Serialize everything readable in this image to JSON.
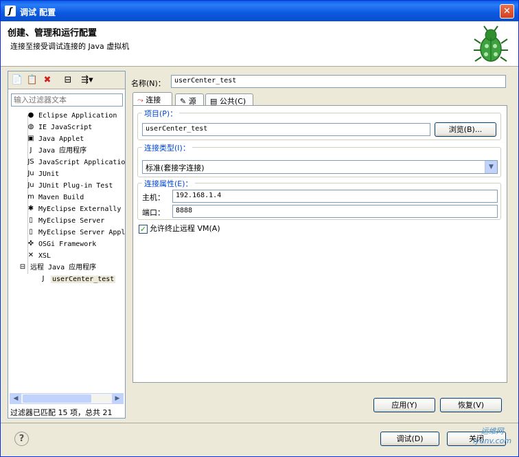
{
  "window": {
    "title": "调试 配置"
  },
  "header": {
    "title": "创建、管理和运行配置",
    "subtitle": "连接至接受调试连接的 Java 虚拟机"
  },
  "left": {
    "filter_placeholder": "输入过滤器文本",
    "tree": [
      {
        "label": "Eclipse Application",
        "icon": "eclipse-icon"
      },
      {
        "label": "IE JavaScript",
        "icon": "globe-icon"
      },
      {
        "label": "Java Applet",
        "icon": "applet-icon"
      },
      {
        "label": "Java 应用程序",
        "icon": "java-app-icon"
      },
      {
        "label": "JavaScript Applicatio",
        "icon": "js-icon"
      },
      {
        "label": "JUnit",
        "icon": "junit-icon"
      },
      {
        "label": "JUnit Plug-in Test",
        "icon": "junit-plugin-icon"
      },
      {
        "label": "Maven Build",
        "icon": "maven-icon"
      },
      {
        "label": "MyEclipse Externally",
        "icon": "external-icon"
      },
      {
        "label": "MyEclipse Server",
        "icon": "server-icon"
      },
      {
        "label": "MyEclipse Server Appl",
        "icon": "server-app-icon"
      },
      {
        "label": "OSGi Framework",
        "icon": "osgi-icon"
      },
      {
        "label": "XSL",
        "icon": "xsl-icon"
      },
      {
        "label": "远程 Java 应用程序",
        "icon": "remote-java-icon"
      },
      {
        "label": "userCenter_test",
        "icon": "config-icon"
      }
    ],
    "status": "过滤器已匹配 15 项，总共 21"
  },
  "right": {
    "name_label": "名称(N)：",
    "name_value": "userCenter_test",
    "tabs": [
      {
        "label": "连接",
        "icon": "connect-icon"
      },
      {
        "label": "源",
        "icon": "source-icon"
      },
      {
        "label": "公共(C)",
        "icon": "common-icon"
      }
    ],
    "project": {
      "label": "项目(P)：",
      "value": "userCenter_test",
      "browse": "浏览(B)..."
    },
    "conn_type": {
      "label": "连接类型(I)：",
      "value": "标准(套接字连接)"
    },
    "conn_props": {
      "label": "连接属性(E)：",
      "host_label": "主机：",
      "host_value": "192.168.1.4",
      "port_label": "端口：",
      "port_value": "8888"
    },
    "allow_terminate": "允许终止远程 VM(A)",
    "apply": "应用(Y)",
    "revert": "恢复(V)"
  },
  "footer": {
    "debug": "调试(D)",
    "close": "关闭"
  },
  "watermark": {
    "line1": "运维网",
    "line2": "iyunv.com"
  }
}
